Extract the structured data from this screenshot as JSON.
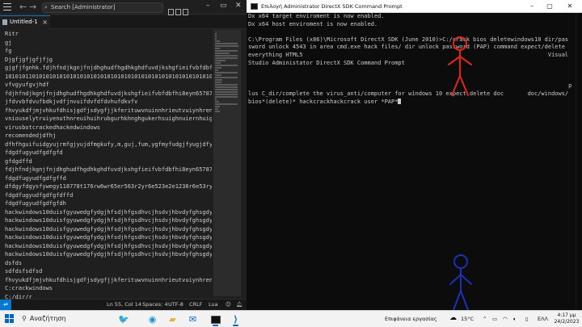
{
  "vscode": {
    "search_text": "Search [Administrator]",
    "tab_label": "Untitled-1",
    "lines": [
      "Ritr",
      "gj",
      "fg",
      "Djgfjgfjgfjfjg",
      "gjgfjfgnhk.fdjhfndjkgnjfnjdhghudfhgdhkghdfuvdjkshgfieifvbfdbfhi",
      "1010101101010101010101010101010101010101010101010101010101010101",
      "vfvgyufgvjhdf",
      "fdjhfndjkgnjfnjdhghudfhgdhkghdfuvdjkshgfieifvbfdbfhi8eyn657876",
      "jfdvvbfdvufbdkjvdfjnvuifdvfdfdvhufdkvfv",
      "fhvyukdfjmjvhkufdhisjgdfjsdygfjjkferituwvnuinnhrieutvuiynhrento",
      "vniouselytruiyenuthnreuihuihrubgurhkhnghgukerhsuighnuiernhuigr",
      "virusbotcrackedhackedwindows",
      "recomendedjdfhj",
      "dfhfhguifuidgyujrmfgjyujdfmgkufy,m,guj,fum,ygfmyfudgjfyugjdfyu",
      "fdgdfugyudfgdfgfd",
      "gfdgdffd",
      "fdjhfndjkgnjfnjdhghudfhgdhkghdfuvdjkshgfieifvbfdbfhi8eyn657876",
      "fdgdfugyudfgdfgffd",
      "dfdgyfdgysfywegy118778t176rw6wr65er563r2yr6e523e2e1236r6e53ry6e",
      "fdgdfugyudfgdfgfdffd",
      "fdgdfugyudfgdfgfdh",
      "hackwindows10duisfgyuwedgfydgjhfsdjhfgsdhvcjhsdvjhbvdyfghsgdyfh",
      "hackwindows10duisfgyuwedgfydgjhfsdjhfgsdhvcjhsdvjhbvdyfghsgdyfh",
      "hackwindows10duisfgyuwedgfydgjhfsdjhfgsdhvcjhsdvjhbvdyfghsgdyfh",
      "hackwindows10duisfgyuwedgfydgjhfsdjhfgsdhvcjhsdvjhbvdyfghsgdyfh",
      "hackwindows10duisfgyuwedgfydgjhfsdjhfgsdhvcjhsdvjhbvdyfghsgdyfh",
      "hackwindows10duisfgyuwedgfydgjhfsdjhfgsdhvcjhsdvjhbvdyfghsgdyfh",
      "dsfds",
      "sdfdsfsdfsd",
      "fhvyukdfjmjvhkufdhisjgdfjsdygfjjkferituwvnuinnhrieutvuiynhrento",
      "C:crackwindows",
      "C:/dir/r",
      "C:/deletebios"
    ],
    "status": {
      "position": "Ln 55, Col 14",
      "spaces": "Spaces: 4",
      "encoding": "UTF-8",
      "eol": "CRLF",
      "language": "Lua"
    }
  },
  "cmd": {
    "title": "Επιλογή Administrator DirectX SDK Command Prompt",
    "lines": [
      "Dx x64 target enviroment is now enabled.",
      "Dx x64 host enviroment is now enabled.",
      "",
      "C:\\Program Files (x86)\\Microsoft DirectX SDK (June 2010)>C:/crack bios deletewindows10 dir/pas",
      "sword unlock 4543 in area cmd.exe hack files/ dir unlock password (PAP) command expect/delete",
      "everything HTML5                                                                        Visual",
      "Studio Administator DirectX SDK Command Prompt",
      "",
      "",
      "                                                                                              p",
      "lus C_dir/complete the virus_anti/computer for windows 10 expect delete doc       doc/windows/",
      "bios*(delete)* hackcrackhackcrack user *PAP*"
    ]
  },
  "taskbar": {
    "search_label": "Αναζήτηση",
    "weather_label": "Επιφάνεια εργασίας",
    "temperature": "15°C",
    "language": "ΕΛΛ",
    "time": "4:17 μμ",
    "date": "24/2/2023"
  },
  "colors": {
    "vscode_bg": "#1f1f1f",
    "cmd_bg": "#0c0c0c",
    "accent": "#0078d4",
    "stickman_red": "#e0261c",
    "stickman_blue": "#1f2fb8"
  }
}
